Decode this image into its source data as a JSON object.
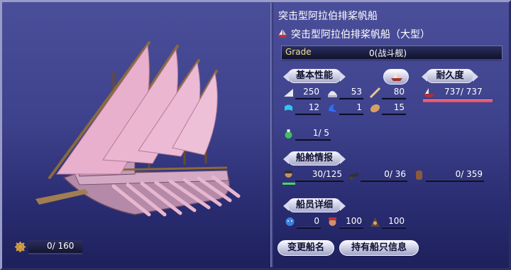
{
  "ship": {
    "type_name": "突击型阿拉伯排桨帆船",
    "full_name": "突击型阿拉伯排桨帆船（大型）",
    "grade_label": "Grade",
    "grade_value": "0(战斗舰)"
  },
  "sections": {
    "basic": "基本性能",
    "durability": "耐久度",
    "cabin": "船舱情报",
    "crew": "船员详细"
  },
  "stats": {
    "sail": "250",
    "armor": "53",
    "oar": "80",
    "turn": "12",
    "wave": "1",
    "cargo": "15",
    "durability": "737/ 737",
    "special": "1/ 5",
    "sailors": "30/125",
    "cannons": "0/ 36",
    "hold": "0/ 359",
    "crew_a": "0",
    "crew_b": "100",
    "crew_c": "100",
    "gold": "0/ 160"
  },
  "buttons": {
    "rename": "变更船名",
    "owned_info": "持有船只信息"
  },
  "colors": {
    "sail_pink": "#e8b0cc",
    "hull_pink": "#c896b4",
    "durability_bar": "#e2506c",
    "sailor_bar": "#49d85c"
  }
}
